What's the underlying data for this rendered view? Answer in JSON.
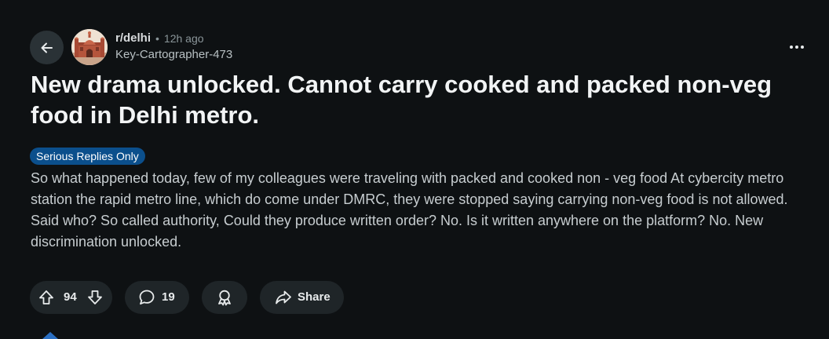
{
  "post": {
    "subreddit": "r/delhi",
    "separator": "•",
    "time_ago": "12h ago",
    "author": "Key-Cartographer-473",
    "title": "New drama unlocked. Cannot carry cooked and packed non-veg food in Delhi metro.",
    "flair": "Serious Replies Only",
    "body": "So what happened today, few of my colleagues were traveling with packed and cooked non - veg food At cybercity metro station the rapid metro line, which do come under DMRC, they were stopped saying carrying non-veg food is not allowed. Said who? So called authority, Could they produce written order? No. Is it written anywhere on the platform? No. New discrimination unlocked."
  },
  "actions": {
    "score": "94",
    "comments": "19",
    "share_label": "Share"
  },
  "icons": {
    "back": "arrow-left-icon",
    "avatar": "red-fort-avatar",
    "more": "more-horizontal-icon",
    "upvote": "upvote-arrow-icon",
    "downvote": "downvote-arrow-icon",
    "comment": "speech-bubble-icon",
    "award": "award-ribbon-icon",
    "share": "share-arrow-icon"
  },
  "colors": {
    "background": "#0e1113",
    "flair_bg": "#0b4f8c",
    "button_bg": "#1f2528"
  }
}
